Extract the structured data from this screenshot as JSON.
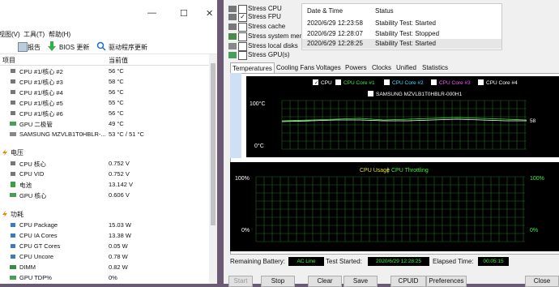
{
  "hwinfo": {
    "menu": [
      "视图(V)",
      "工具(T)",
      "帮助(H)"
    ],
    "toolbar": {
      "report": "报告",
      "bios": "BIOS 更新",
      "driver": "驱动程序更新"
    },
    "columns": {
      "item": "项目",
      "value": "当前值"
    },
    "rows_temp": [
      {
        "label": "CPU #1/核心 #2",
        "value": "56 °C"
      },
      {
        "label": "CPU #1/核心 #3",
        "value": "58 °C"
      },
      {
        "label": "CPU #1/核心 #4",
        "value": "56 °C"
      },
      {
        "label": "CPU #1/核心 #5",
        "value": "55 °C"
      },
      {
        "label": "CPU #1/核心 #6",
        "value": "56 °C"
      },
      {
        "label": "GPU 二极管",
        "value": "49 °C"
      },
      {
        "label": "SAMSUNG MZVLB1T0HBLR-...",
        "value": "53 °C / 51 °C"
      }
    ],
    "section_voltage": "电压",
    "rows_voltage": [
      {
        "label": "CPU 核心",
        "value": "0.752 V"
      },
      {
        "label": "CPU VID",
        "value": "0.752 V"
      },
      {
        "label": "电池",
        "value": "13.142 V"
      },
      {
        "label": "GPU 核心",
        "value": "0.606 V"
      }
    ],
    "section_power": "功耗",
    "rows_power": [
      {
        "label": "CPU Package",
        "value": "15.03 W"
      },
      {
        "label": "CPU IA Cores",
        "value": "13.38 W"
      },
      {
        "label": "CPU GT Cores",
        "value": "0.05 W"
      },
      {
        "label": "CPU Uncore",
        "value": "0.78 W"
      },
      {
        "label": "DIMM",
        "value": "0.82 W"
      },
      {
        "label": "GPU TDP%",
        "value": "0%"
      }
    ]
  },
  "stability": {
    "options": [
      {
        "label": "Stress CPU",
        "checked": false
      },
      {
        "label": "Stress FPU",
        "checked": true
      },
      {
        "label": "Stress cache",
        "checked": false
      },
      {
        "label": "Stress system memo",
        "checked": false
      },
      {
        "label": "Stress local disks",
        "checked": false
      },
      {
        "label": "Stress GPU(s)",
        "checked": false
      }
    ],
    "log_headers": {
      "date": "Date & Time",
      "status": "Status"
    },
    "log": [
      {
        "date": "2020/6/29 12:23:58",
        "status": "Stability Test: Started"
      },
      {
        "date": "2020/6/29 12:28:07",
        "status": "Stability Test: Stopped"
      },
      {
        "date": "2020/6/29 12:28:25",
        "status": "Stability Test: Started"
      }
    ],
    "tabs": [
      "Temperatures",
      "Cooling Fans",
      "Voltages",
      "Powers",
      "Clocks",
      "Unified",
      "Statistics"
    ],
    "chart1_legend": [
      {
        "label": "CPU",
        "color": "#ffffff"
      },
      {
        "label": "CPU Core #1",
        "color": "#3ef03e"
      },
      {
        "label": "CPU Core #2",
        "color": "#44ddff"
      },
      {
        "label": "CPU Core #3",
        "color": "#ff55ff"
      },
      {
        "label": "CPU Core #4",
        "color": "#ffffff"
      }
    ],
    "chart1_legend2": "SAMSUNG MZVLB1T0HBLR-000H1",
    "chart1_ymax": "100°C",
    "chart1_ymin": "0°C",
    "chart1_value": "58",
    "chart2_title_a": "CPU Usage",
    "chart2_sep": "|",
    "chart2_title_b": "CPU Throttling",
    "chart2_ymax_l": "100%",
    "chart2_ymin_l": "0%",
    "chart2_ymax_r": "100%",
    "chart2_ymin_r": "0%",
    "status": {
      "battery_label": "Remaining Battery:",
      "battery_value": "AC Line",
      "started_label": "Test Started:",
      "started_value": "2020/6/29 12:28:25",
      "elapsed_label": "Elapsed Time:",
      "elapsed_value": "00:05:15"
    },
    "buttons": [
      "Start",
      "Stop",
      "Clear",
      "Save",
      "CPUID",
      "Preferences",
      "Close"
    ]
  }
}
